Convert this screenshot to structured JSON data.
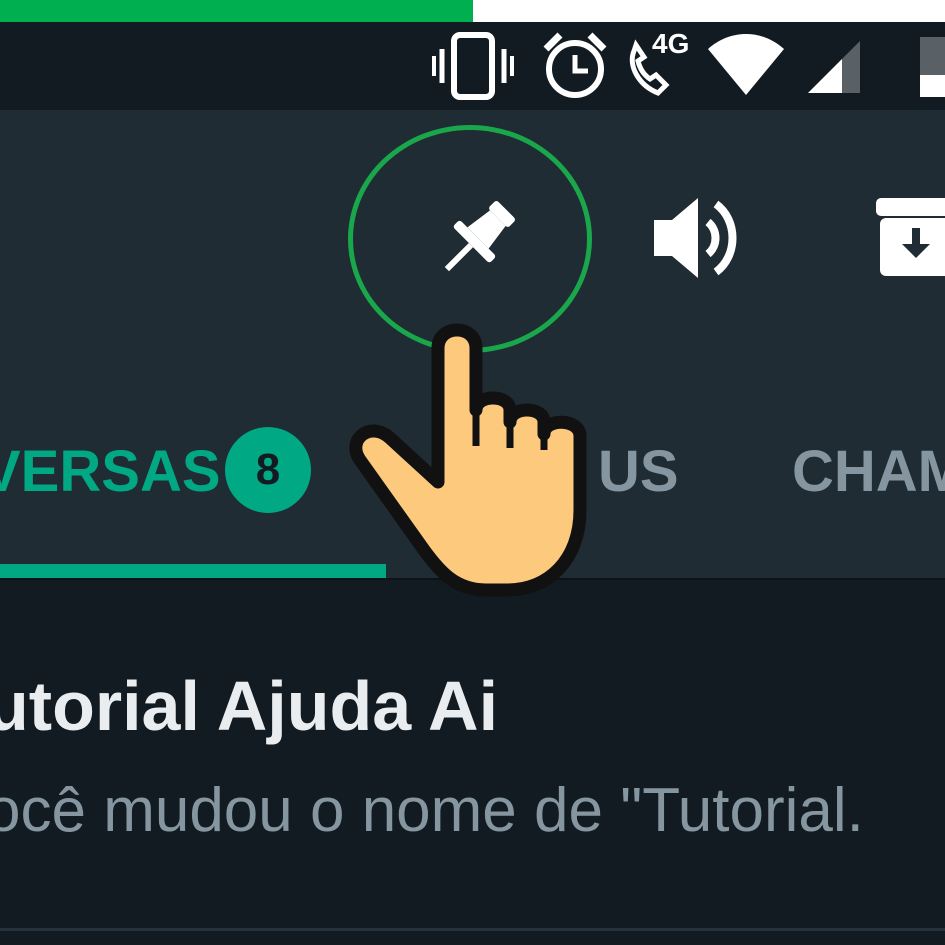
{
  "progress": {
    "fraction": 0.5,
    "color": "#00b050"
  },
  "status_bar": {
    "network_label": "4G",
    "icons": [
      "vibrate-icon",
      "alarm-icon",
      "wifi-call-icon",
      "wifi-icon",
      "signal-icon",
      "battery-icon"
    ]
  },
  "toolbar": {
    "actions": [
      "pin-icon",
      "mute-icon",
      "archive-icon"
    ],
    "highlighted_action": "pin-icon",
    "highlight_color": "#1aa64a"
  },
  "tabs": {
    "items": [
      {
        "label": "VERSAS",
        "active": true,
        "badge": "8"
      },
      {
        "label": "US",
        "active": false
      },
      {
        "label": "CHAM",
        "active": false
      }
    ],
    "accent_color": "#00a884"
  },
  "chat": {
    "title": "utorial Ajuda Ai",
    "preview": "ocê mudou o nome de \"Tutorial."
  },
  "overlay": {
    "pointer": "pointing-hand-icon"
  }
}
